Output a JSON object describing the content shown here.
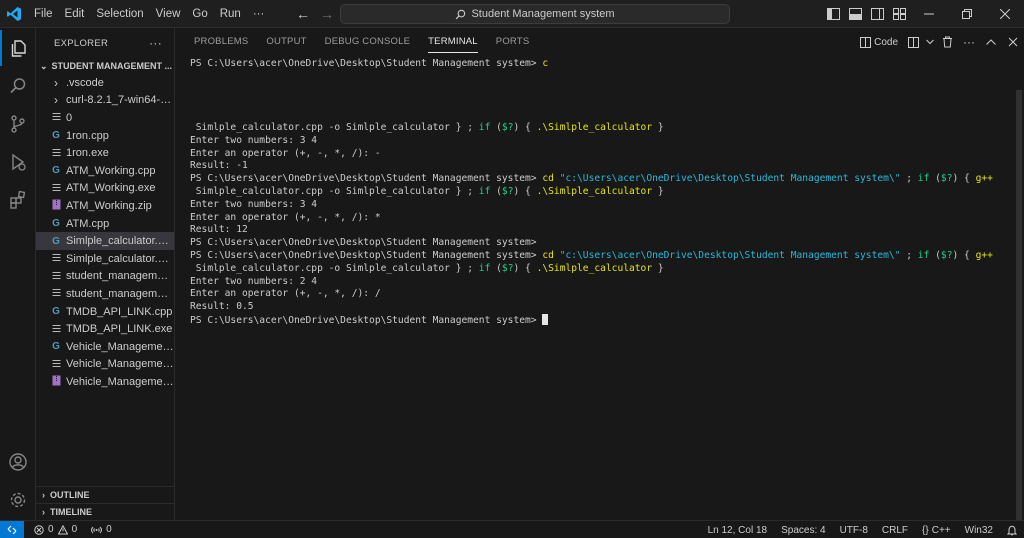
{
  "menu": [
    "File",
    "Edit",
    "Selection",
    "View",
    "Go",
    "Run",
    "···"
  ],
  "search": {
    "text": "Student Management system"
  },
  "explorer": {
    "title": "EXPLORER",
    "more": "···",
    "folder": "STUDENT MANAGEMENT ...",
    "items": [
      {
        "label": ".vscode",
        "icon": "chevron-right",
        "type": "folder"
      },
      {
        "label": "curl-8.2.1_7-win64-mi...",
        "icon": "chevron-right",
        "type": "folder"
      },
      {
        "label": "0",
        "icon": "file-lines",
        "type": "file"
      },
      {
        "label": "1ron.cpp",
        "icon": "cpp",
        "type": "cpp"
      },
      {
        "label": "1ron.exe",
        "icon": "file-lines",
        "type": "file"
      },
      {
        "label": "ATM_Working.cpp",
        "icon": "cpp",
        "type": "cpp"
      },
      {
        "label": "ATM_Working.exe",
        "icon": "file-lines",
        "type": "file"
      },
      {
        "label": "ATM_Working.zip",
        "icon": "zip",
        "type": "zip"
      },
      {
        "label": "ATM.cpp",
        "icon": "cpp",
        "type": "cpp"
      },
      {
        "label": "Simlple_calculator.cpp",
        "icon": "cpp",
        "type": "cpp",
        "selected": true
      },
      {
        "label": "Simlple_calculator.exe",
        "icon": "file-lines",
        "type": "file"
      },
      {
        "label": "student_management....",
        "icon": "file-lines",
        "type": "file"
      },
      {
        "label": "student_management....",
        "icon": "file-lines",
        "type": "file"
      },
      {
        "label": "TMDB_API_LINK.cpp",
        "icon": "cpp",
        "type": "cpp"
      },
      {
        "label": "TMDB_API_LINK.exe",
        "icon": "file-lines",
        "type": "file"
      },
      {
        "label": "Vehicle_Management....",
        "icon": "cpp",
        "type": "cpp"
      },
      {
        "label": "Vehicle_Management....",
        "icon": "file-lines",
        "type": "file"
      },
      {
        "label": "Vehicle_Management....",
        "icon": "zip",
        "type": "zip"
      }
    ],
    "outline": "OUTLINE",
    "timeline": "TIMELINE"
  },
  "panel": {
    "tabs": [
      "PROBLEMS",
      "OUTPUT",
      "DEBUG CONSOLE",
      "TERMINAL",
      "PORTS"
    ],
    "active_tab": "TERMINAL",
    "code_label": "Code"
  },
  "terminal": {
    "lines": [
      [
        {
          "t": "PS C:\\Users\\acer\\OneDrive\\Desktop\\Student Management system> "
        },
        {
          "t": "c",
          "c": "yellow"
        }
      ],
      [],
      [],
      [],
      [],
      [
        {
          "t": " Simlple_calculator.cpp -o Simlple_calculator } ; "
        },
        {
          "t": "if",
          "c": "green"
        },
        {
          "t": " ("
        },
        {
          "t": "$?",
          "c": "green"
        },
        {
          "t": ") { "
        },
        {
          "t": ".\\Simlple_calculator",
          "c": "yellow"
        },
        {
          "t": " }"
        }
      ],
      [
        {
          "t": "Enter two numbers: 3 4"
        }
      ],
      [
        {
          "t": "Enter an operator (+, -, *, /): -"
        }
      ],
      [
        {
          "t": "Result: -1"
        }
      ],
      [
        {
          "t": "PS C:\\Users\\acer\\OneDrive\\Desktop\\Student Management system> "
        },
        {
          "t": "cd",
          "c": "yellow"
        },
        {
          "t": " "
        },
        {
          "t": "\"c:\\Users\\acer\\OneDrive\\Desktop\\Student Management system\\\"",
          "c": "cyan"
        },
        {
          "t": " ; "
        },
        {
          "t": "if",
          "c": "green"
        },
        {
          "t": " ("
        },
        {
          "t": "$?",
          "c": "green"
        },
        {
          "t": ") { "
        },
        {
          "t": "g++",
          "c": "yellow"
        }
      ],
      [
        {
          "t": " Simlple_calculator.cpp -o Simlple_calculator } ; "
        },
        {
          "t": "if",
          "c": "green"
        },
        {
          "t": " ("
        },
        {
          "t": "$?",
          "c": "green"
        },
        {
          "t": ") { "
        },
        {
          "t": ".\\Simlple_calculator",
          "c": "yellow"
        },
        {
          "t": " }"
        }
      ],
      [
        {
          "t": "Enter two numbers: 3 4"
        }
      ],
      [
        {
          "t": "Enter an operator (+, -, *, /): *"
        }
      ],
      [
        {
          "t": "Result: 12"
        }
      ],
      [
        {
          "t": "PS C:\\Users\\acer\\OneDrive\\Desktop\\Student Management system>"
        }
      ],
      [
        {
          "t": "PS C:\\Users\\acer\\OneDrive\\Desktop\\Student Management system> "
        },
        {
          "t": "cd",
          "c": "yellow"
        },
        {
          "t": " "
        },
        {
          "t": "\"c:\\Users\\acer\\OneDrive\\Desktop\\Student Management system\\\"",
          "c": "cyan"
        },
        {
          "t": " ; "
        },
        {
          "t": "if",
          "c": "green"
        },
        {
          "t": " ("
        },
        {
          "t": "$?",
          "c": "green"
        },
        {
          "t": ") { "
        },
        {
          "t": "g++",
          "c": "yellow"
        }
      ],
      [
        {
          "t": " Simlple_calculator.cpp -o Simlple_calculator } ; "
        },
        {
          "t": "if",
          "c": "green"
        },
        {
          "t": " ("
        },
        {
          "t": "$?",
          "c": "green"
        },
        {
          "t": ") { "
        },
        {
          "t": ".\\Simlple_calculator",
          "c": "yellow"
        },
        {
          "t": " }"
        }
      ],
      [
        {
          "t": "Enter two numbers: 2 4"
        }
      ],
      [
        {
          "t": "Enter an operator (+, -, *, /): /"
        }
      ],
      [
        {
          "t": "Result: 0.5"
        }
      ],
      [
        {
          "t": "PS C:\\Users\\acer\\OneDrive\\Desktop\\Student Management system> "
        },
        {
          "cursor": true
        }
      ]
    ]
  },
  "status": {
    "errors": "0",
    "warnings": "0",
    "ports": "0",
    "position": "Ln 12, Col 18",
    "spaces": "Spaces: 4",
    "encoding": "UTF-8",
    "eol": "CRLF",
    "language": "C++",
    "platform": "Win32"
  },
  "colors": {
    "accent": "#0078d4",
    "terminal_yellow": "#e5e510",
    "terminal_green": "#23d18b",
    "terminal_cyan": "#29b8db",
    "cpp_icon": "#519aba",
    "zip_icon": "#a074c4"
  }
}
